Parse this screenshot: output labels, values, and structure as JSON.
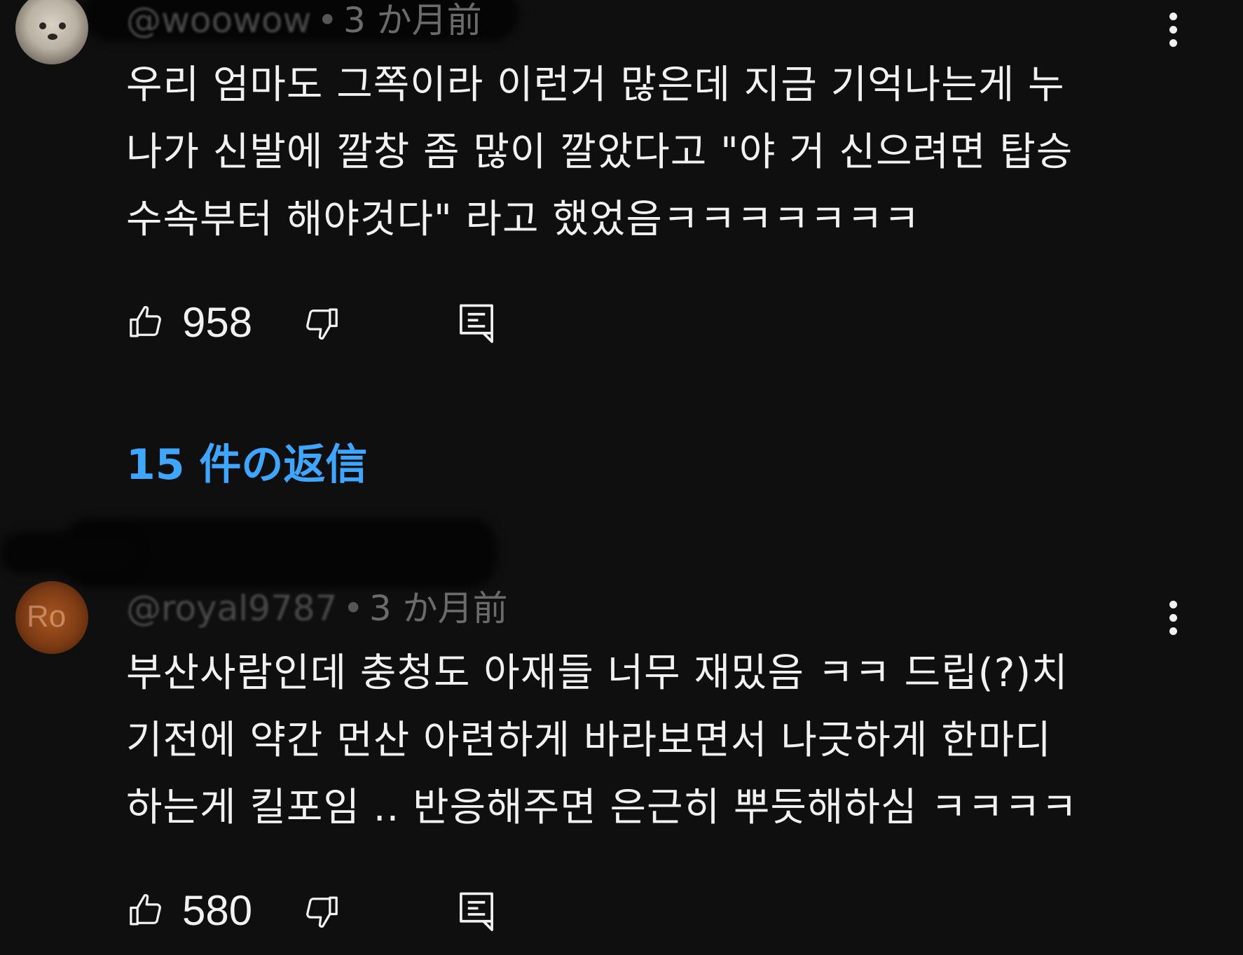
{
  "comments": [
    {
      "handle": "@woowow",
      "time": "3 か月前",
      "lines": [
        "우리 엄마도 그쪽이라 이런거 많은데 지금 기억나는게 누",
        "나가 신발에 깔창 좀 많이 깔았다고 \"야 거 신으려면 탑승",
        "수속부터 해야것다\" 라고 했었음ㅋㅋㅋㅋㅋㅋㅋ"
      ],
      "likes": "958",
      "replies_label": "15 件の返信"
    },
    {
      "handle": "@royal9787",
      "avatar_initials": "Ro",
      "time": "3 か月前",
      "lines": [
        "부산사람인데 충청도 아재들 너무 재밌음 ㅋㅋ 드립(?)치",
        "기전에 약간 먼산 아련하게 바라보면서 나긋하게 한마디",
        "하는게 킬포임  .. 반응해주면 은근히 뿌듯해하심 ㅋㅋㅋㅋ"
      ],
      "likes": "580"
    }
  ],
  "icons": {
    "like": "thumbs-up-icon",
    "dislike": "thumbs-down-icon",
    "reply": "reply-comment-icon",
    "more": "more-vertical-icon"
  },
  "colors": {
    "background": "#0f0f0f",
    "text": "#f1f1f1",
    "meta": "#6b6b6b",
    "link": "#3ea6ff"
  }
}
